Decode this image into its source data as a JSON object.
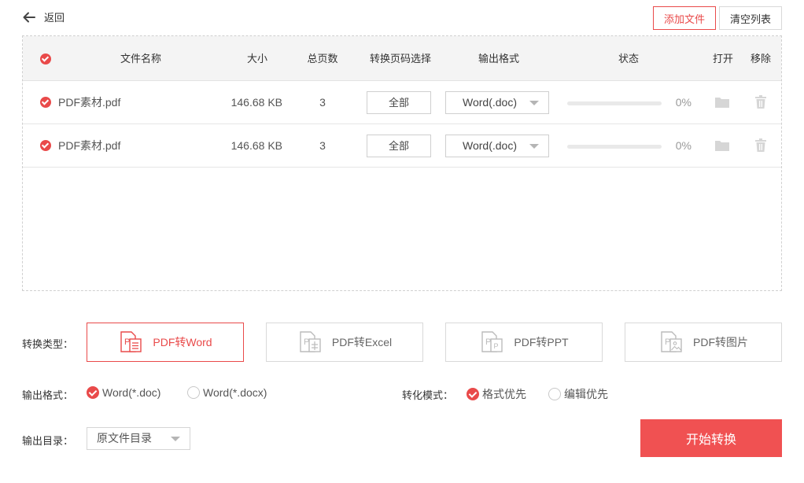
{
  "nav": {
    "back_label": "返回"
  },
  "toolbar": {
    "add_label": "添加文件",
    "clear_label": "清空列表"
  },
  "table": {
    "headers": {
      "name": "文件名称",
      "size": "大小",
      "pages": "总页数",
      "range": "转换页码选择",
      "format": "输出格式",
      "status": "状态",
      "open": "打开",
      "remove": "移除"
    },
    "rows": [
      {
        "name": "PDF素材.pdf",
        "size": "146.68 KB",
        "pages": "3",
        "range": "全部",
        "format": "Word(.doc)",
        "progress": 0,
        "percent": "0%"
      },
      {
        "name": "PDF素材.pdf",
        "size": "146.68 KB",
        "pages": "3",
        "range": "全部",
        "format": "Word(.doc)",
        "progress": 0,
        "percent": "0%"
      }
    ]
  },
  "conversion": {
    "type_label": "转换类型：",
    "types": [
      {
        "label": "PDF转Word",
        "icon": "pdf-to-word-icon",
        "active": true
      },
      {
        "label": "PDF转Excel",
        "icon": "pdf-to-excel-icon",
        "active": false
      },
      {
        "label": "PDF转PPT",
        "icon": "pdf-to-ppt-icon",
        "active": false
      },
      {
        "label": "PDF转图片",
        "icon": "pdf-to-image-icon",
        "active": false
      }
    ],
    "format_label": "输出格式：",
    "formats": [
      {
        "label": "Word(*.doc)",
        "selected": true
      },
      {
        "label": "Word(*.docx)",
        "selected": false
      }
    ],
    "mode_label": "转化模式：",
    "modes": [
      {
        "label": "格式优先",
        "selected": true
      },
      {
        "label": "编辑优先",
        "selected": false
      }
    ],
    "dir_label": "输出目录：",
    "dir_value": "原文件目录",
    "start_label": "开始转换"
  },
  "colors": {
    "accent": "#e94a4a",
    "start_button": "#f05152"
  }
}
